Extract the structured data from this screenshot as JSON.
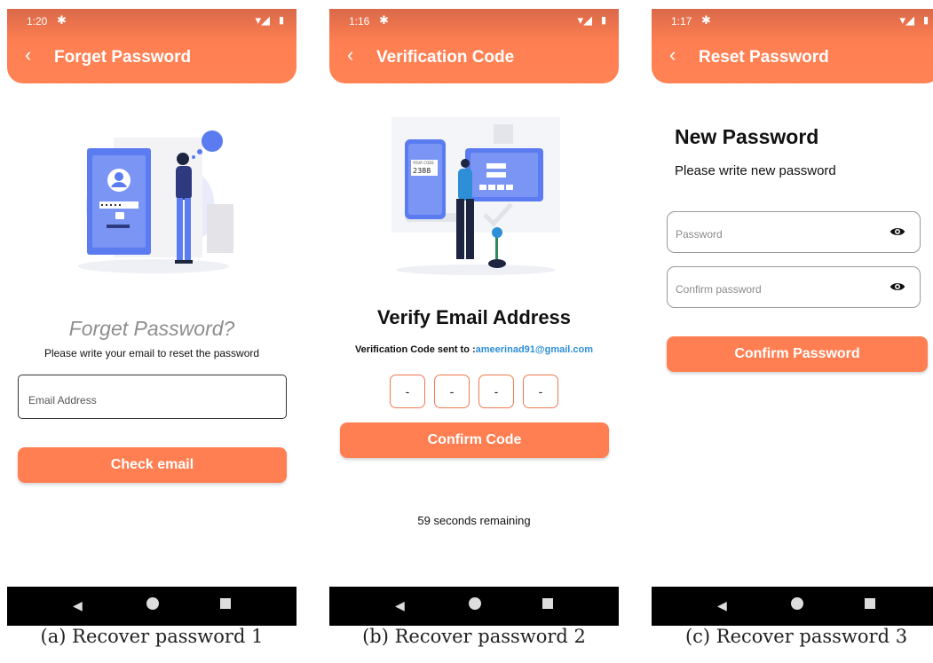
{
  "screens": [
    {
      "status_time": "1:20",
      "header_title": "Forget Password",
      "question_title": "Forget Password?",
      "instruction": "Please write your email to reset the password",
      "email_placeholder": "Email Address",
      "button": "Check email",
      "caption": "(a) Recover password 1"
    },
    {
      "status_time": "1:16",
      "header_title": "Verification Code",
      "illustration_code_label": "YOUR CODE",
      "illustration_code": "2388",
      "title": "Verify Email Address",
      "sent_to_label": "Verification Code sent to :",
      "sent_to_email": "ameerinad91@gmail.com",
      "code_digits": [
        "-",
        "-",
        "-",
        "-"
      ],
      "button": "Confirm Code",
      "timer": "59 seconds remaining",
      "caption": "(b) Recover password 2"
    },
    {
      "status_time": "1:17",
      "header_title": "Reset Password",
      "title": "New Password",
      "subtitle": "Please write new password",
      "password_placeholder": "Password",
      "confirm_placeholder": "Confirm password",
      "button": "Confirm Password",
      "caption": "(c) Recover password 3"
    }
  ],
  "colors": {
    "accent": "#ff7f52",
    "link": "#2e8fd6",
    "illustration_blue": "#5b7cf0"
  },
  "icons": {
    "status": [
      "gear-icon",
      "wifi-icon",
      "signal-icon",
      "battery-icon"
    ],
    "header": "back-arrow-icon",
    "navbar": [
      "nav-back-icon",
      "nav-home-icon",
      "nav-recents-icon"
    ],
    "password_field": "eye-icon"
  }
}
